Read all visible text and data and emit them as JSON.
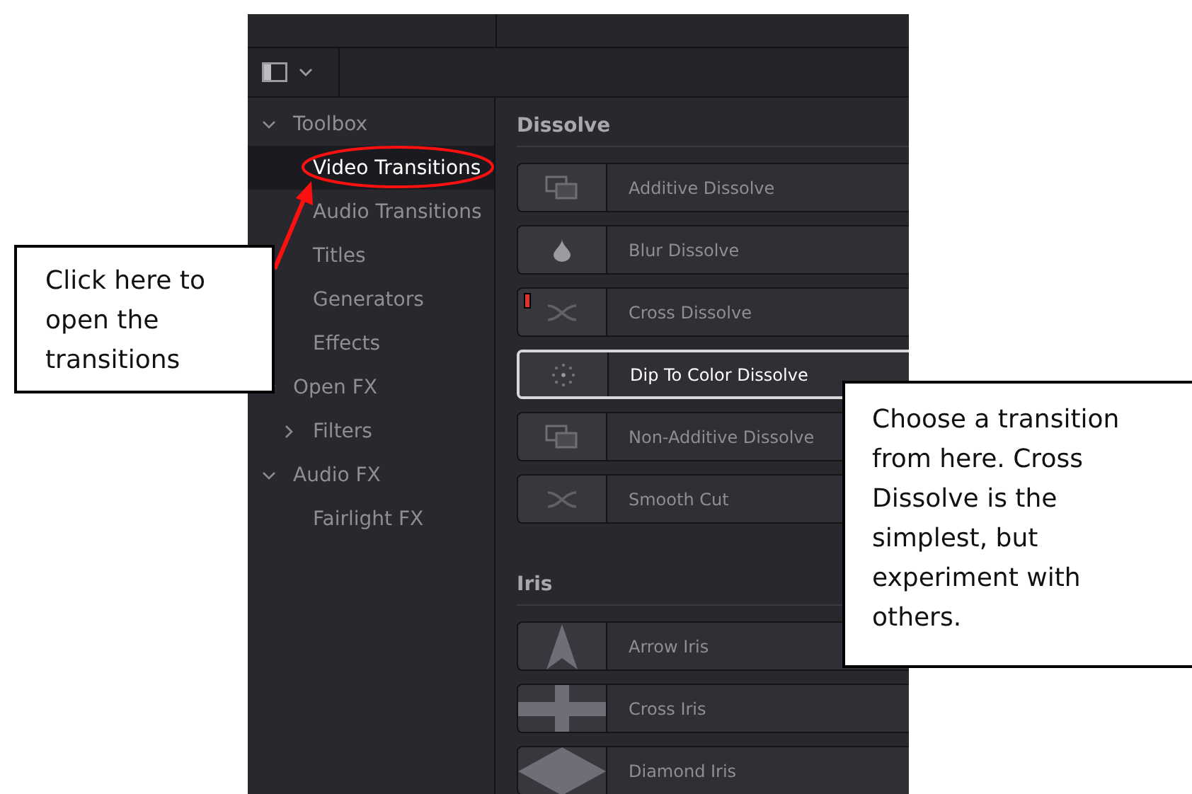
{
  "sidebar": {
    "items": [
      {
        "label": "Toolbox",
        "expanded": true,
        "selected": false,
        "children": [
          {
            "label": "Video Transitions",
            "selected": true
          },
          {
            "label": "Audio Transitions",
            "selected": false
          },
          {
            "label": "Titles",
            "selected": false
          },
          {
            "label": "Generators",
            "selected": false
          },
          {
            "label": "Effects",
            "selected": false
          }
        ]
      },
      {
        "label": "Open FX",
        "expanded": true,
        "selected": false,
        "children": [
          {
            "label": "Filters",
            "expanded": false,
            "selected": false
          }
        ]
      },
      {
        "label": "Audio FX",
        "expanded": true,
        "selected": false,
        "children": [
          {
            "label": "Fairlight FX",
            "selected": false
          }
        ]
      }
    ]
  },
  "sections": [
    {
      "title": "Dissolve",
      "items": [
        {
          "name": "Additive Dissolve",
          "kind": "overlap",
          "selected": false,
          "marked": false
        },
        {
          "name": "Blur Dissolve",
          "kind": "drop",
          "selected": false,
          "marked": false
        },
        {
          "name": "Cross Dissolve",
          "kind": "cross",
          "selected": false,
          "marked": true
        },
        {
          "name": "Dip To Color Dissolve",
          "kind": "dots",
          "selected": true,
          "marked": false
        },
        {
          "name": "Non-Additive Dissolve",
          "kind": "overlap",
          "selected": false,
          "marked": false
        },
        {
          "name": "Smooth Cut",
          "kind": "cross",
          "selected": false,
          "marked": false
        }
      ]
    },
    {
      "title": "Iris",
      "items": [
        {
          "name": "Arrow Iris",
          "kind": "arrow",
          "selected": false,
          "marked": false
        },
        {
          "name": "Cross Iris",
          "kind": "plus",
          "selected": false,
          "marked": false
        },
        {
          "name": "Diamond Iris",
          "kind": "diamond",
          "selected": false,
          "marked": false
        }
      ]
    }
  ],
  "callouts": [
    {
      "text": "Click here to open the transitions"
    },
    {
      "text": "Choose a transition from here. Cross Dissolve is the simplest, but experiment with others."
    }
  ]
}
